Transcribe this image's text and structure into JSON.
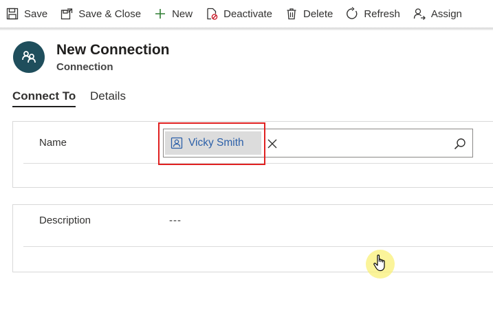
{
  "toolbar": {
    "save": "Save",
    "save_close": "Save & Close",
    "new": "New",
    "deactivate": "Deactivate",
    "delete": "Delete",
    "refresh": "Refresh",
    "assign": "Assign"
  },
  "header": {
    "title": "New Connection",
    "entity": "Connection"
  },
  "tabs": [
    "Connect To",
    "Details"
  ],
  "form": {
    "name_label": "Name",
    "name_value": "Vicky Smith",
    "description_label": "Description",
    "description_value": "---"
  },
  "colors": {
    "avatar": "#1f4e5c",
    "lookup_link": "#2b5fa8",
    "highlight": "#e02020",
    "cursor_halo": "#faf078"
  }
}
